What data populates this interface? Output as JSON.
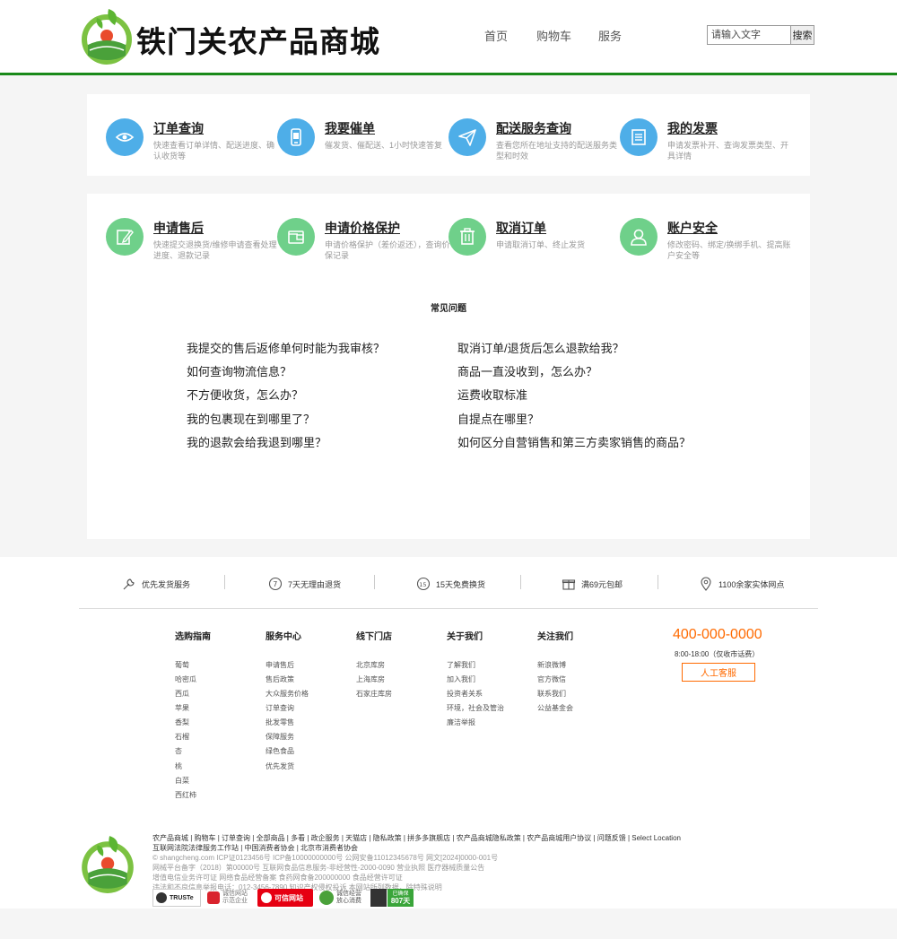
{
  "header": {
    "site_title": "铁门关农产品商城",
    "nav": [
      "首页",
      "购物车",
      "服务"
    ],
    "search_placeholder": "请输入文字",
    "search_button": "搜索"
  },
  "services_top": [
    {
      "title": "订单查询",
      "desc": "快速查看订单详情、配送进度、确认收货等",
      "icon": "eye-icon"
    },
    {
      "title": "我要催单",
      "desc": "催发货、催配送、1小时快速答复",
      "icon": "phone-icon"
    },
    {
      "title": "配送服务查询",
      "desc": "查看您所在地址支持的配送服务类型和时效",
      "icon": "paper-plane-icon"
    },
    {
      "title": "我的发票",
      "desc": "申请发票补开、查询发票类型、开具详情",
      "icon": "invoice-icon"
    }
  ],
  "services_bottom": [
    {
      "title": "申请售后",
      "desc": "快速提交退换货/维修申请查看处理进度、退款记录",
      "icon": "edit-icon"
    },
    {
      "title": "申请价格保护",
      "desc": "申请价格保护（差价返还），查询价保记录",
      "icon": "wallet-icon"
    },
    {
      "title": "取消订单",
      "desc": "申请取消订单、终止发货",
      "icon": "trash-icon"
    },
    {
      "title": "账户安全",
      "desc": "修改密码、绑定/换绑手机、提高账户安全等",
      "icon": "user-icon"
    }
  ],
  "faq": {
    "heading": "常见问题",
    "left": [
      "我提交的售后返修单何时能为我审核？",
      "如何查询物流信息？",
      "不方便收货，怎么办？",
      "我的包裹现在到哪里了？",
      "我的退款会给我退到哪里？"
    ],
    "right": [
      "取消订单/退货后怎么退款给我？",
      "商品一直没收到，怎么办？",
      "运费收取标准",
      "自提点在哪里？",
      "如何区分自营销售和第三方卖家销售的商品？"
    ]
  },
  "guarantees": [
    {
      "text": "优先发货服务",
      "icon": "wrench-icon"
    },
    {
      "text": "7天无理由退货",
      "icon": "seven-days-icon"
    },
    {
      "text": "15天免费换货",
      "icon": "fifteen-days-icon"
    },
    {
      "text": "满69元包邮",
      "icon": "gift-icon"
    },
    {
      "text": "1100余家实体网点",
      "icon": "location-icon"
    }
  ],
  "footer_columns": [
    {
      "title": "选购指南",
      "links": [
        "葡萄",
        "哈密瓜",
        "西瓜",
        "苹果",
        "香梨",
        "石榴",
        "杏",
        "桃",
        "白菜",
        "西红柿"
      ]
    },
    {
      "title": "服务中心",
      "links": [
        "申请售后",
        "售后政策",
        "大众服务价格",
        "订单查询",
        "批发零售",
        "保障服务",
        "绿色食品",
        "优先发货"
      ]
    },
    {
      "title": "线下门店",
      "links": [
        "北京库房",
        "上海库房",
        "石家庄库房"
      ]
    },
    {
      "title": "关于我们",
      "links": [
        "了解我们",
        "加入我们",
        "投资者关系",
        "环境，社会及管治",
        "廉洁举报"
      ]
    },
    {
      "title": "关注我们",
      "links": [
        "新浪微博",
        "官方微信",
        "联系我们",
        "公益基金会"
      ]
    }
  ],
  "contact": {
    "phone": "400-000-0000",
    "hours": "8:00-18:00（仅收市话费）",
    "kefu_button": "人工客服"
  },
  "bottom_info": {
    "links_line1": "农产品商城 | 购物车 | 订单查询 | 全部商品 | 多看 | 政企服务 | 天猫店 | 隐私政策 | 拼多多旗舰店 | 农产品商城隐私政策 | 农产品商城用户协议 | 问题反馈 | Select Location",
    "links_line2": "互联网法院法律服务工作站 | 中国消费者协会 | 北京市消费者协会",
    "line3": "© shangcheng.com ICP证0123456号 ICP备10000000000号 公网安备11012345678号 网文[2024]0000-001号",
    "line4": "网械平台备字（2018）第00000号 互联网食品信息服务-非经营性-2000-0090 营业执照 医疗器械质量公告",
    "line5": "增值电信业务许可证 网络食品经营备案 食药网食备200000000 食品经营许可证",
    "line6": "违法和不良信息举报电话：012-3456-7890 知识产权侵权投诉 本网站所列数据，除特殊说明"
  },
  "badges": [
    {
      "text": "TRUSTe",
      "sub": "隐私认证"
    },
    {
      "text": "诚信网站",
      "sub": "示范企业"
    },
    {
      "text": "可信网站",
      "sub": ""
    },
    {
      "text": "诚信经营",
      "sub": "放心消费"
    },
    {
      "text": "807天",
      "sub": "已确保"
    }
  ],
  "colors": {
    "brand_green": "#1a8a1a",
    "blue_circle": "#4eaee8",
    "green_circle": "#6fd08a",
    "accent_orange": "#ff6a00"
  }
}
